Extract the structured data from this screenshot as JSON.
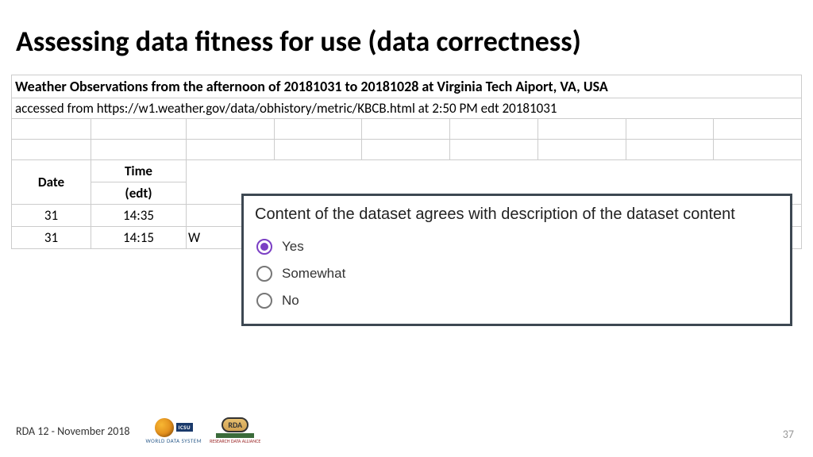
{
  "title": "Assessing data fitness for use (data correctness)",
  "table": {
    "heading": "Weather Observations from the afternoon of 20181031 to 20181028 at Virginia Tech Aiport, VA, USA",
    "subheading": "accessed from https://w1.weather.gov/data/obhistory/metric/KBCB.html at 2:50 PM edt 20181031",
    "headers": {
      "date": "Date",
      "time_line1": "Time",
      "time_line2": "(edt)"
    },
    "rows": [
      {
        "date": "31",
        "time": "14:35",
        "rest": ""
      },
      {
        "date": "31",
        "time": "14:15",
        "rest": "W"
      }
    ]
  },
  "popup": {
    "question": "Content of the dataset agrees with description of the dataset content",
    "options": [
      {
        "label": "Yes",
        "selected": true
      },
      {
        "label": "Somewhat",
        "selected": false
      },
      {
        "label": "No",
        "selected": false
      }
    ]
  },
  "footer": {
    "label": "RDA 12 - November 2018",
    "wds": "WORLD DATA SYSTEM",
    "icsu": "ICSU",
    "rda": "RDA",
    "rda_sub": "RESEARCH DATA ALLIANCE"
  },
  "page_number": "37"
}
